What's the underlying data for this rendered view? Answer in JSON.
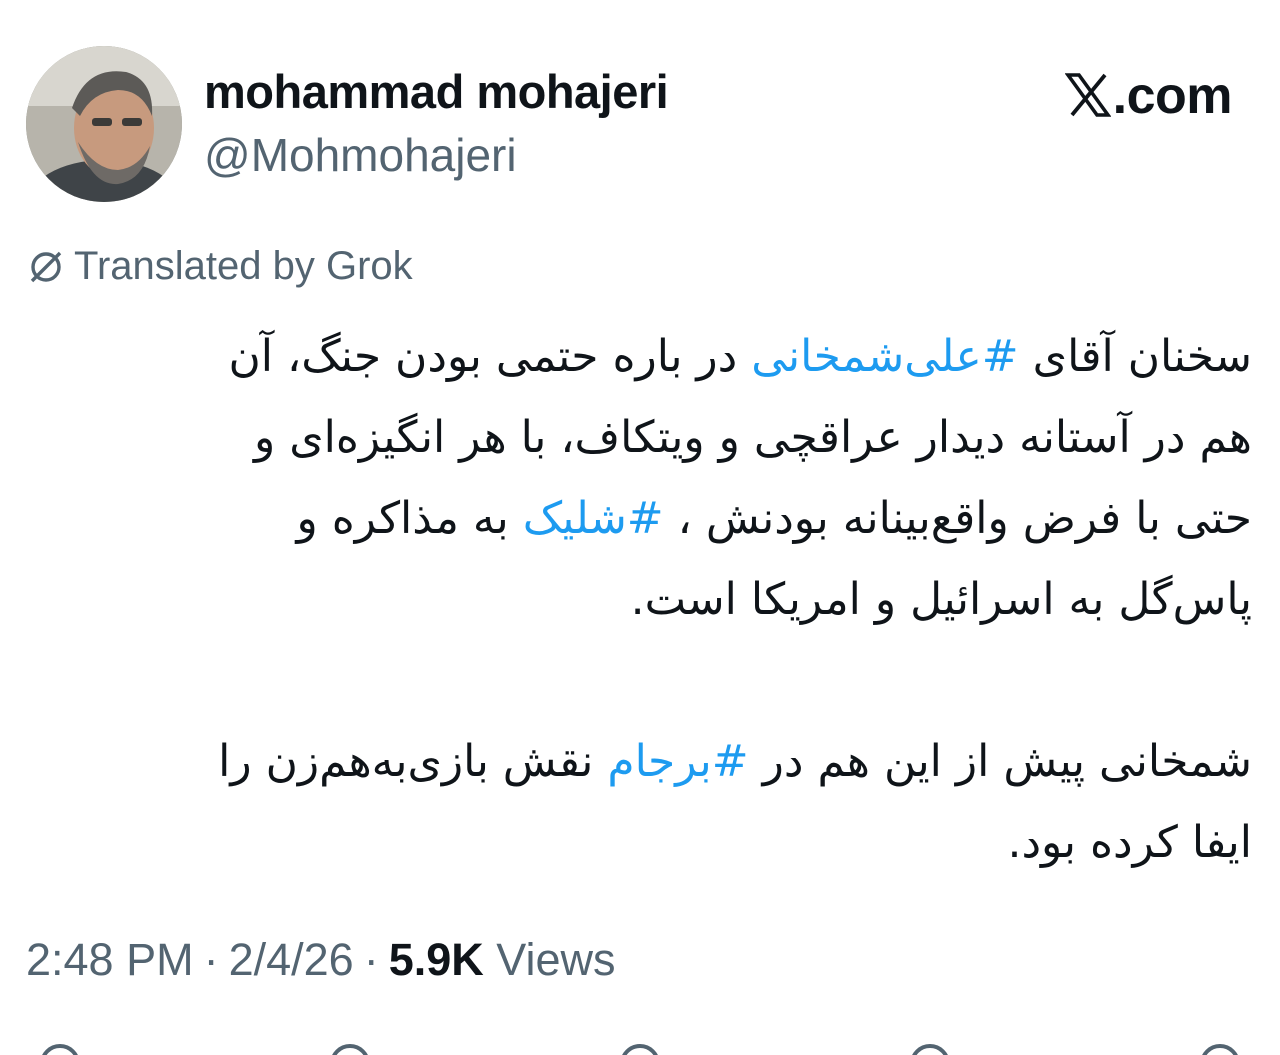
{
  "user": {
    "display_name": "mohammad mohajeri",
    "handle": "@Mohmohajeri"
  },
  "brand": {
    "icon": "x-logo-icon",
    "domain": ".com"
  },
  "translation": {
    "icon": "grok-icon",
    "label": "Translated by Grok"
  },
  "tweet": {
    "p1": {
      "l1_a": "سخنان آقای ",
      "l1_tag": "#علی‌شمخانی",
      "l1_b": " در باره حتمی بودن جنگ، آن",
      "l2": "هم در آستانه دیدار عراقچی و ویتکاف، با هر انگیزه‌ای و",
      "l3_a": "حتی با فرض  واقع‌بینانه بودنش ، ",
      "l3_tag": "#شلیک",
      "l3_b": " به مذاکره و",
      "l4": "پاس‌گل به اسرائیل و امریکا است."
    },
    "p2": {
      "l1_a": "شمخانی پیش از این هم در ",
      "l1_tag": "#برجام",
      "l1_b": " نقش بازی‌به‌هم‌زن را",
      "l2": "ایفا کرده بود."
    }
  },
  "meta": {
    "time": "2:48 PM",
    "separator": "·",
    "date": "2/4/26",
    "views_count": "5.9K",
    "views_label": "Views"
  },
  "colors": {
    "text": "#0f1419",
    "secondary": "#536471",
    "link": "#1d9bf0"
  }
}
